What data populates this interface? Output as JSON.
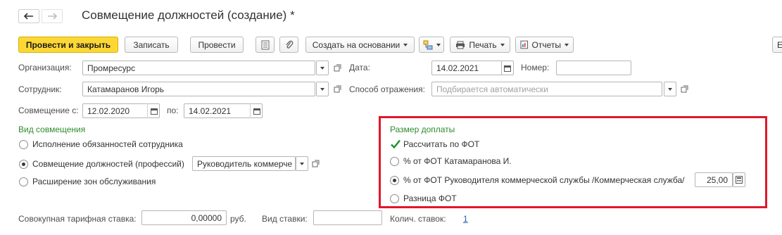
{
  "header": {
    "title": "Совмещение должностей (создание) *"
  },
  "toolbar": {
    "post_close": "Провести и закрыть",
    "save": "Записать",
    "post": "Провести",
    "create_based": "Создать на основании",
    "print": "Печать",
    "reports": "Отчеты",
    "more": "Е"
  },
  "form": {
    "org_label": "Организация:",
    "org_value": "Промресурс",
    "date_label": "Дата:",
    "date_value": "14.02.2021",
    "number_label": "Номер:",
    "number_value": "",
    "employee_label": "Сотрудник:",
    "employee_value": "Катамаранов Игорь",
    "reflection_label": "Способ отражения:",
    "reflection_placeholder": "Подбирается автоматически",
    "combo_from_label": "Совмещение с:",
    "combo_from_value": "12.02.2020",
    "combo_to_label": "по:",
    "combo_to_value": "14.02.2021"
  },
  "combo_type": {
    "title": "Вид совмещения",
    "options": [
      "Исполнение обязанностей сотрудника",
      "Совмещение должностей (профессий)",
      "Расширение зон обслуживания"
    ],
    "selected_index": 1,
    "position_value": "Руководитель коммерче"
  },
  "pay_size": {
    "title": "Размер доплаты",
    "checkbox_label": "Рассчитать по ФОТ",
    "checkbox_checked": true,
    "options": [
      "% от ФОТ Катамаранова И.",
      "% от ФОТ Руководителя коммерческой службы /Коммерческая служба/",
      "Разница ФОТ"
    ],
    "selected_index": 1,
    "percent_value": "25,00"
  },
  "footer": {
    "rate_label": "Совокупная тарифная ставка:",
    "rate_value": "0,00000",
    "rate_unit": "руб.",
    "rate_type_label": "Вид ставки:",
    "rate_type_value": "",
    "count_label": "Колич. ставок:",
    "count_value": "1"
  },
  "colors": {
    "primary_button": "#fdd835",
    "group_title": "#2e8b2e",
    "highlight_border": "#e0182a",
    "link": "#2a5fb0"
  }
}
